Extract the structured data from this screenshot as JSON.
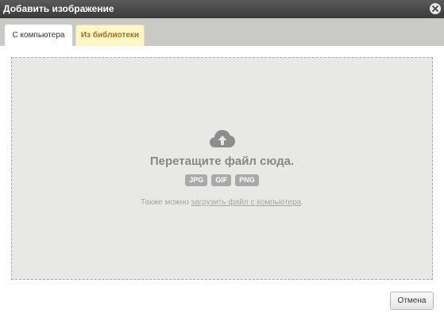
{
  "dialog": {
    "title": "Добавить изображение",
    "close_icon": "close-circle-icon"
  },
  "tabs": [
    {
      "label": "С компьютера",
      "active": true
    },
    {
      "label": "Из библиотеки",
      "active": false
    }
  ],
  "dropzone": {
    "icon": "cloud-upload-icon",
    "title": "Перетащите файл сюда.",
    "formats": [
      "JPG",
      "GIF",
      "PNG"
    ],
    "hint_prefix": "Также можно ",
    "hint_link": "загрузить файл с компьютера",
    "hint_suffix": "."
  },
  "footer": {
    "cancel_label": "Отмена"
  }
}
